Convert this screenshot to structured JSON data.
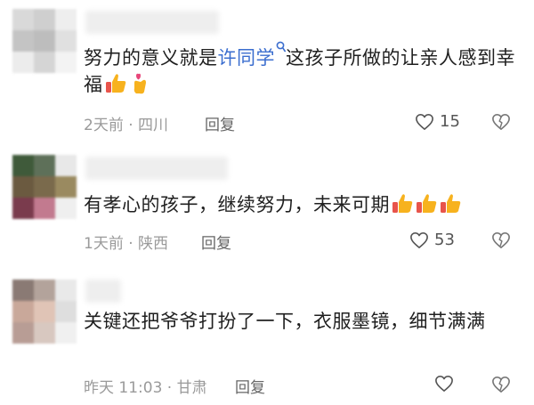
{
  "comments": [
    {
      "avatar_colors": [
        "#d9d9d9",
        "#cfcfcf",
        "#eeeeee",
        "#c4c4c4",
        "#bdbdbd",
        "#e0e0e0",
        "#ececec",
        "#d5d5d5",
        "#f3f3f3"
      ],
      "text_before_mention": "努力的意义就是",
      "mention": "许同学",
      "mention_icon": "search-icon",
      "text_after_mention": "这孩子所做的让亲人感到幸福",
      "emojis": [
        "thumbs-up-icon",
        "finger-heart-icon"
      ],
      "meta": "2天前 · 四川",
      "reply_label": "回复",
      "like_count": "15"
    },
    {
      "avatar_colors": [
        "#3f5a3a",
        "#5e7059",
        "#e8e8e8",
        "#6b5a40",
        "#7a6a4c",
        "#9a8a60",
        "#7a3b4d",
        "#c27a8f",
        "#efefef"
      ],
      "text": "有孝心的孩子，继续努力，未来可期",
      "emojis": [
        "thumbs-up-icon",
        "thumbs-up-icon",
        "thumbs-up-icon"
      ],
      "meta": "1天前 · 陕西",
      "reply_label": "回复",
      "like_count": "53"
    },
    {
      "avatar_colors": [
        "#8a7a74",
        "#b3a39b",
        "#e9e9e9",
        "#c9a89a",
        "#e0c4b6",
        "#dedede",
        "#b89d95",
        "#d8c8c0",
        "#f0f0f0"
      ],
      "text": "关键还把爷爷打扮了一下，衣服墨镜，细节满满",
      "emojis": [],
      "meta": "昨天 11:03 · 甘肃",
      "reply_label": "回复",
      "like_count": ""
    }
  ]
}
